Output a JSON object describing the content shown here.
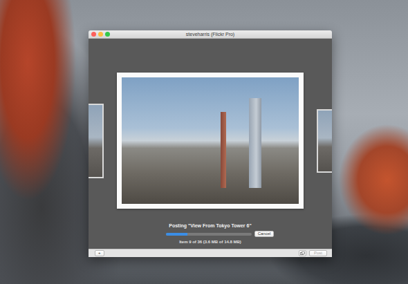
{
  "window": {
    "title": "steveharris (Flickr Pro)"
  },
  "upload": {
    "posting": "Posting \"View From Tokyo Tower 6\"",
    "level": 0.25,
    "progress_text": "Item 9 of 36 (3.6 MB of 14.8 MB)",
    "cancel": {
      "label": "Cancel",
      "disabled": false
    }
  },
  "bottom_bar": {
    "add": {
      "label": "+",
      "disabled": false
    },
    "post": {
      "label": "Post",
      "disabled": true
    }
  }
}
